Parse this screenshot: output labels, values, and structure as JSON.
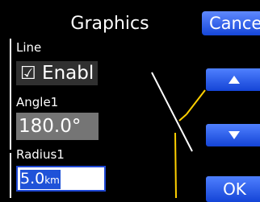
{
  "dialog": {
    "title": "Graphics",
    "cancel_label": "Cancel",
    "ok_label": "OK"
  },
  "form": {
    "line": {
      "label": "Line",
      "checked": true,
      "check_glyph": "☑",
      "value": "Enabl"
    },
    "angle1": {
      "label": "Angle1",
      "value": "180.0°"
    },
    "radius1": {
      "label": "Radius1",
      "value": "5.0",
      "unit": "km"
    }
  },
  "icons": {
    "up": "up-arrow-icon",
    "down": "down-arrow-icon"
  },
  "colors": {
    "background": "#000000",
    "button_blue": "#1f52d8",
    "selection_blue": "#1f52d8",
    "angle_field": "#757575",
    "checkbox_field": "#303030",
    "preview_white": "#ffffff",
    "preview_yellow": "#ffd000"
  }
}
